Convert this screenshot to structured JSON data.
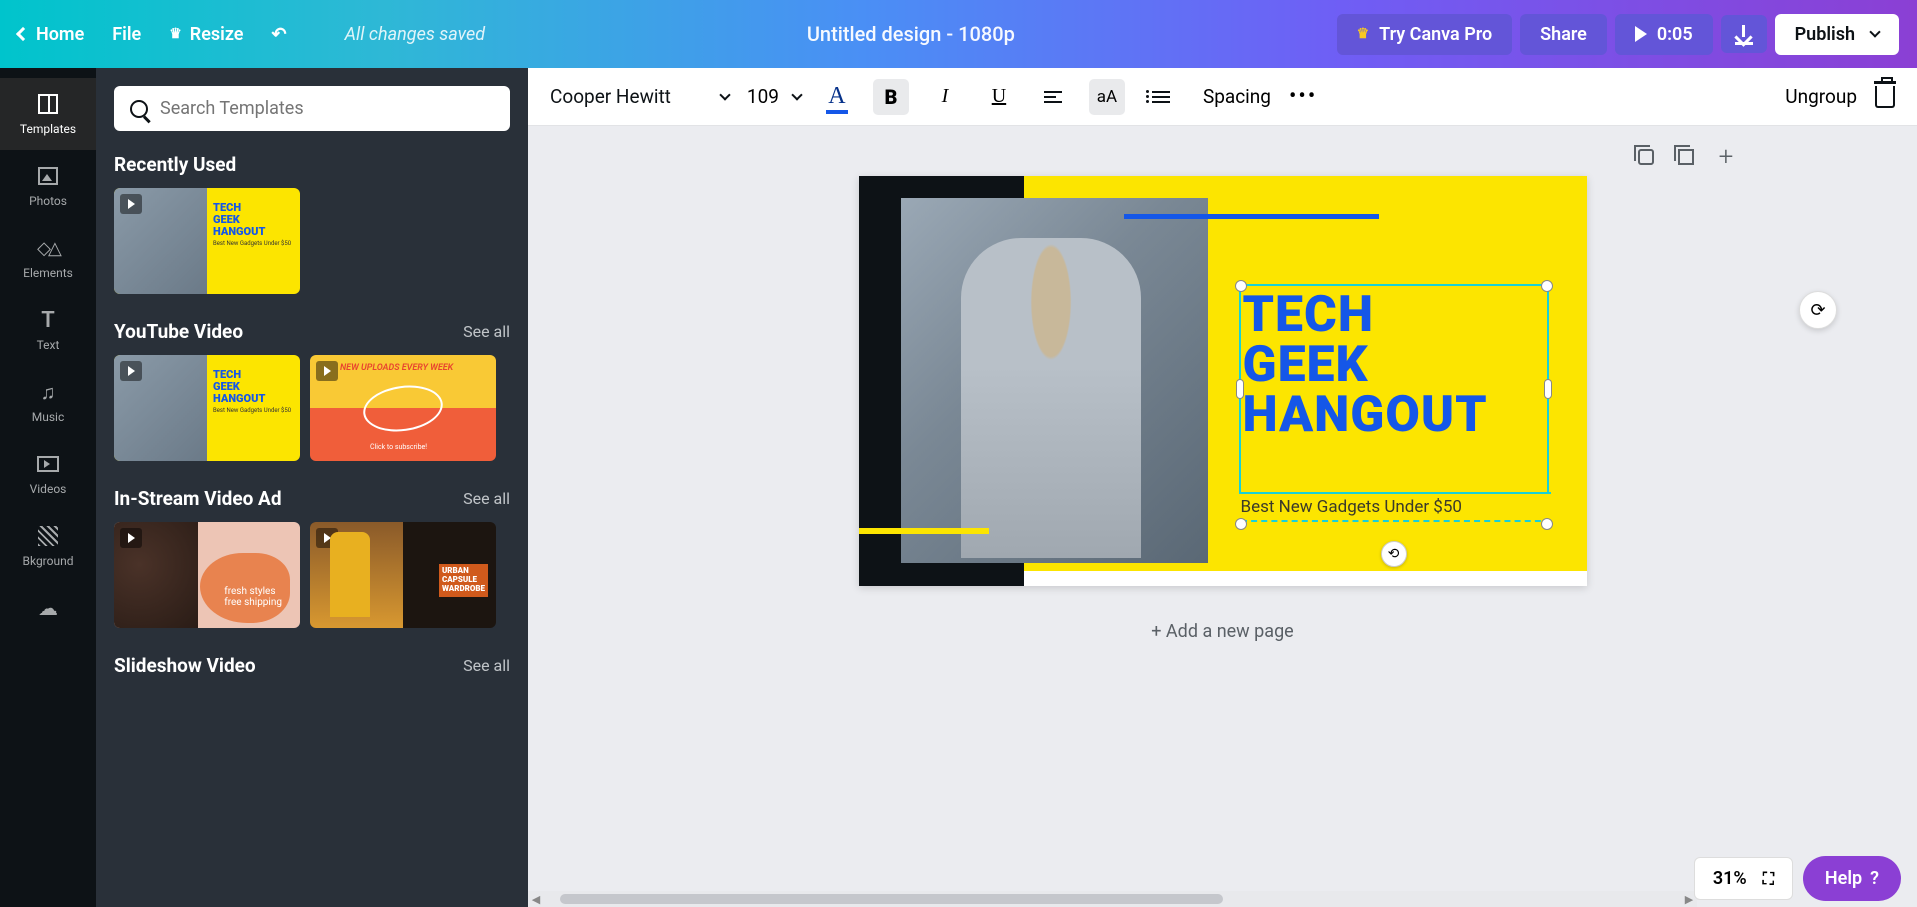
{
  "topbar": {
    "home": "Home",
    "file": "File",
    "resize": "Resize",
    "save_status": "All changes saved",
    "doc_title": "Untitled design - 1080p",
    "try_pro": "Try Canva Pro",
    "share": "Share",
    "timer": "0:05",
    "publish": "Publish"
  },
  "rail": {
    "templates": "Templates",
    "photos": "Photos",
    "elements": "Elements",
    "text": "Text",
    "music": "Music",
    "videos": "Videos",
    "bkground": "Bkground"
  },
  "panel": {
    "search_placeholder": "Search Templates",
    "sections": {
      "recently_used": {
        "title": "Recently Used"
      },
      "youtube": {
        "title": "YouTube Video",
        "see_all": "See all"
      },
      "instream": {
        "title": "In-Stream Video Ad",
        "see_all": "See all"
      },
      "slideshow": {
        "title": "Slideshow Video",
        "see_all": "See all"
      }
    },
    "thumbs": {
      "tech": {
        "line1": "TECH",
        "line2": "GEEK",
        "line3": "HANGOUT",
        "sub": "Best New Gadgets Under $50"
      },
      "uploads": {
        "headline": "NEW UPLOADS EVERY WEEK",
        "sub": "Click to subscribe!"
      },
      "fresh": {
        "line1": "fresh styles",
        "line2": "free shipping"
      },
      "urban": {
        "line1": "URBAN",
        "line2": "CAPSULE",
        "line3": "WARDROBE"
      }
    }
  },
  "toolbar": {
    "font_name": "Cooper Hewitt",
    "font_size": "109",
    "spacing": "Spacing",
    "ungroup": "Ungroup"
  },
  "canvas": {
    "title_line1": "TECH",
    "title_line2": "GEEK",
    "title_line3": "HANGOUT",
    "subtitle": "Best New Gadgets Under $50",
    "add_page": "+ Add a new page"
  },
  "bottom": {
    "zoom": "31%",
    "help": "Help"
  }
}
